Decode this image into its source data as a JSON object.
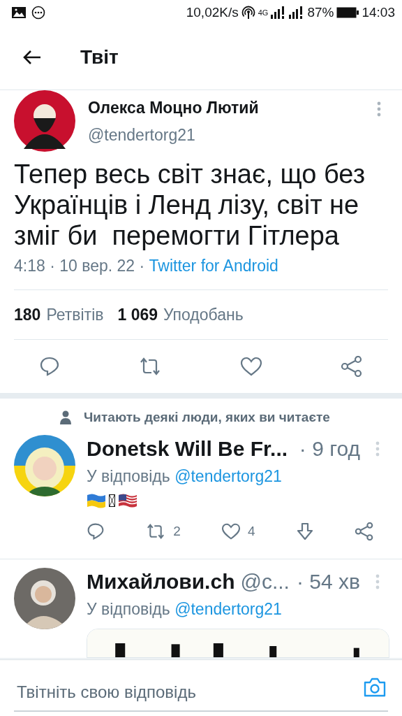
{
  "status_bar": {
    "speed": "10,02K/s",
    "network": "4G",
    "battery": "87%",
    "time": "14:03"
  },
  "header": {
    "title": "Твіт"
  },
  "tweet": {
    "name": "Олекса Моцно Лютий",
    "handle": "@tendertorg21",
    "text": "Тепер весь світ знає, що без Українців і Ленд лізу, світ не зміг би  перемогти Гітлера",
    "time": "4:18 · 10 вер. 22 · ",
    "source": "Twitter for Android",
    "stats": [
      {
        "count": "180",
        "label": "Ретвітів"
      },
      {
        "count": "1 069",
        "label": "Уподобань"
      }
    ]
  },
  "social_context": "Читають деякі люди, яких ви читаєте",
  "replies": [
    {
      "name": "Donetsk Will Be Fr...",
      "time": "· 9 год",
      "reply_prefix": "У відповідь",
      "reply_to": "@tendertorg21",
      "has_flags": true,
      "has_card": false,
      "retweets": "2",
      "likes": "4"
    },
    {
      "name": "Михайлови.ch",
      "handle": "@c...",
      "time": "· 54 хв",
      "reply_prefix": "У відповідь",
      "reply_to": "@tendertorg21",
      "has_flags": false,
      "has_card": true
    }
  ],
  "composer": {
    "placeholder": "Твітніть свою відповідь"
  }
}
